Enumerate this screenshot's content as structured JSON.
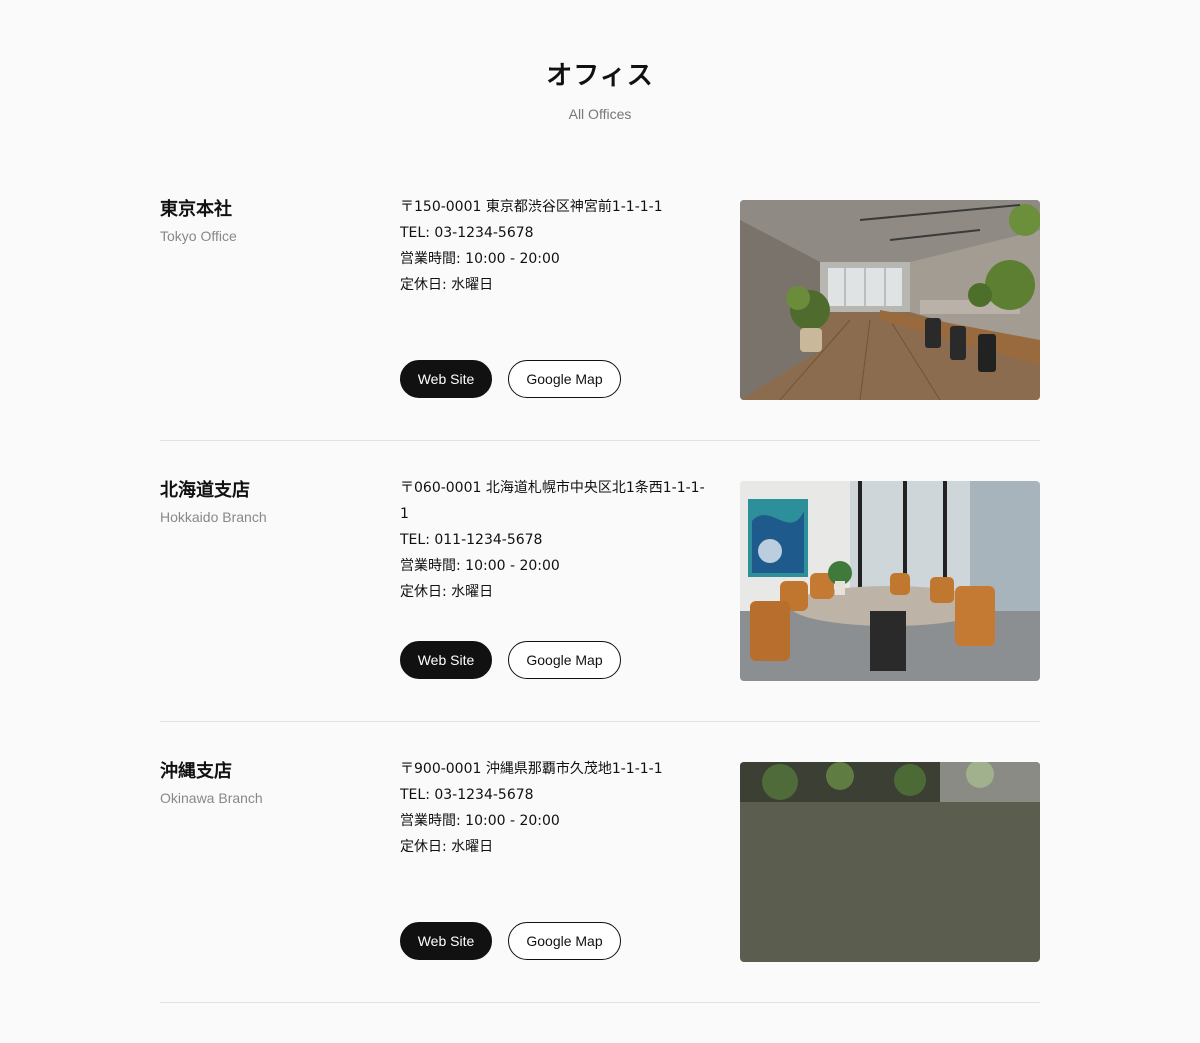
{
  "header": {
    "title": "オフィス",
    "subtitle": "All Offices"
  },
  "offices": [
    {
      "name": "東京本社",
      "name_en": "Tokyo Office",
      "address": "〒150-0001 東京都渋谷区神宮前1-1-1-1",
      "tel": "TEL: 03-1234-5678",
      "hours": "営業時間: 10:00 - 20:00",
      "holiday": "定休日: 水曜日",
      "website_label": "Web Site",
      "map_label": "Google Map"
    },
    {
      "name": "北海道支店",
      "name_en": "Hokkaido Branch",
      "address": "〒060-0001 北海道札幌市中央区北1条西1-1-1-1",
      "tel": "TEL: 011-1234-5678",
      "hours": "営業時間: 10:00 - 20:00",
      "holiday": "定休日: 水曜日",
      "website_label": "Web Site",
      "map_label": "Google Map"
    },
    {
      "name": "沖縄支店",
      "name_en": "Okinawa Branch",
      "address": "〒900-0001 沖縄県那覇市久茂地1-1-1-1",
      "tel": "TEL: 03-1234-5678",
      "hours": "営業時間: 10:00 - 20:00",
      "holiday": "定休日: 水曜日",
      "website_label": "Web Site",
      "map_label": "Google Map"
    }
  ]
}
